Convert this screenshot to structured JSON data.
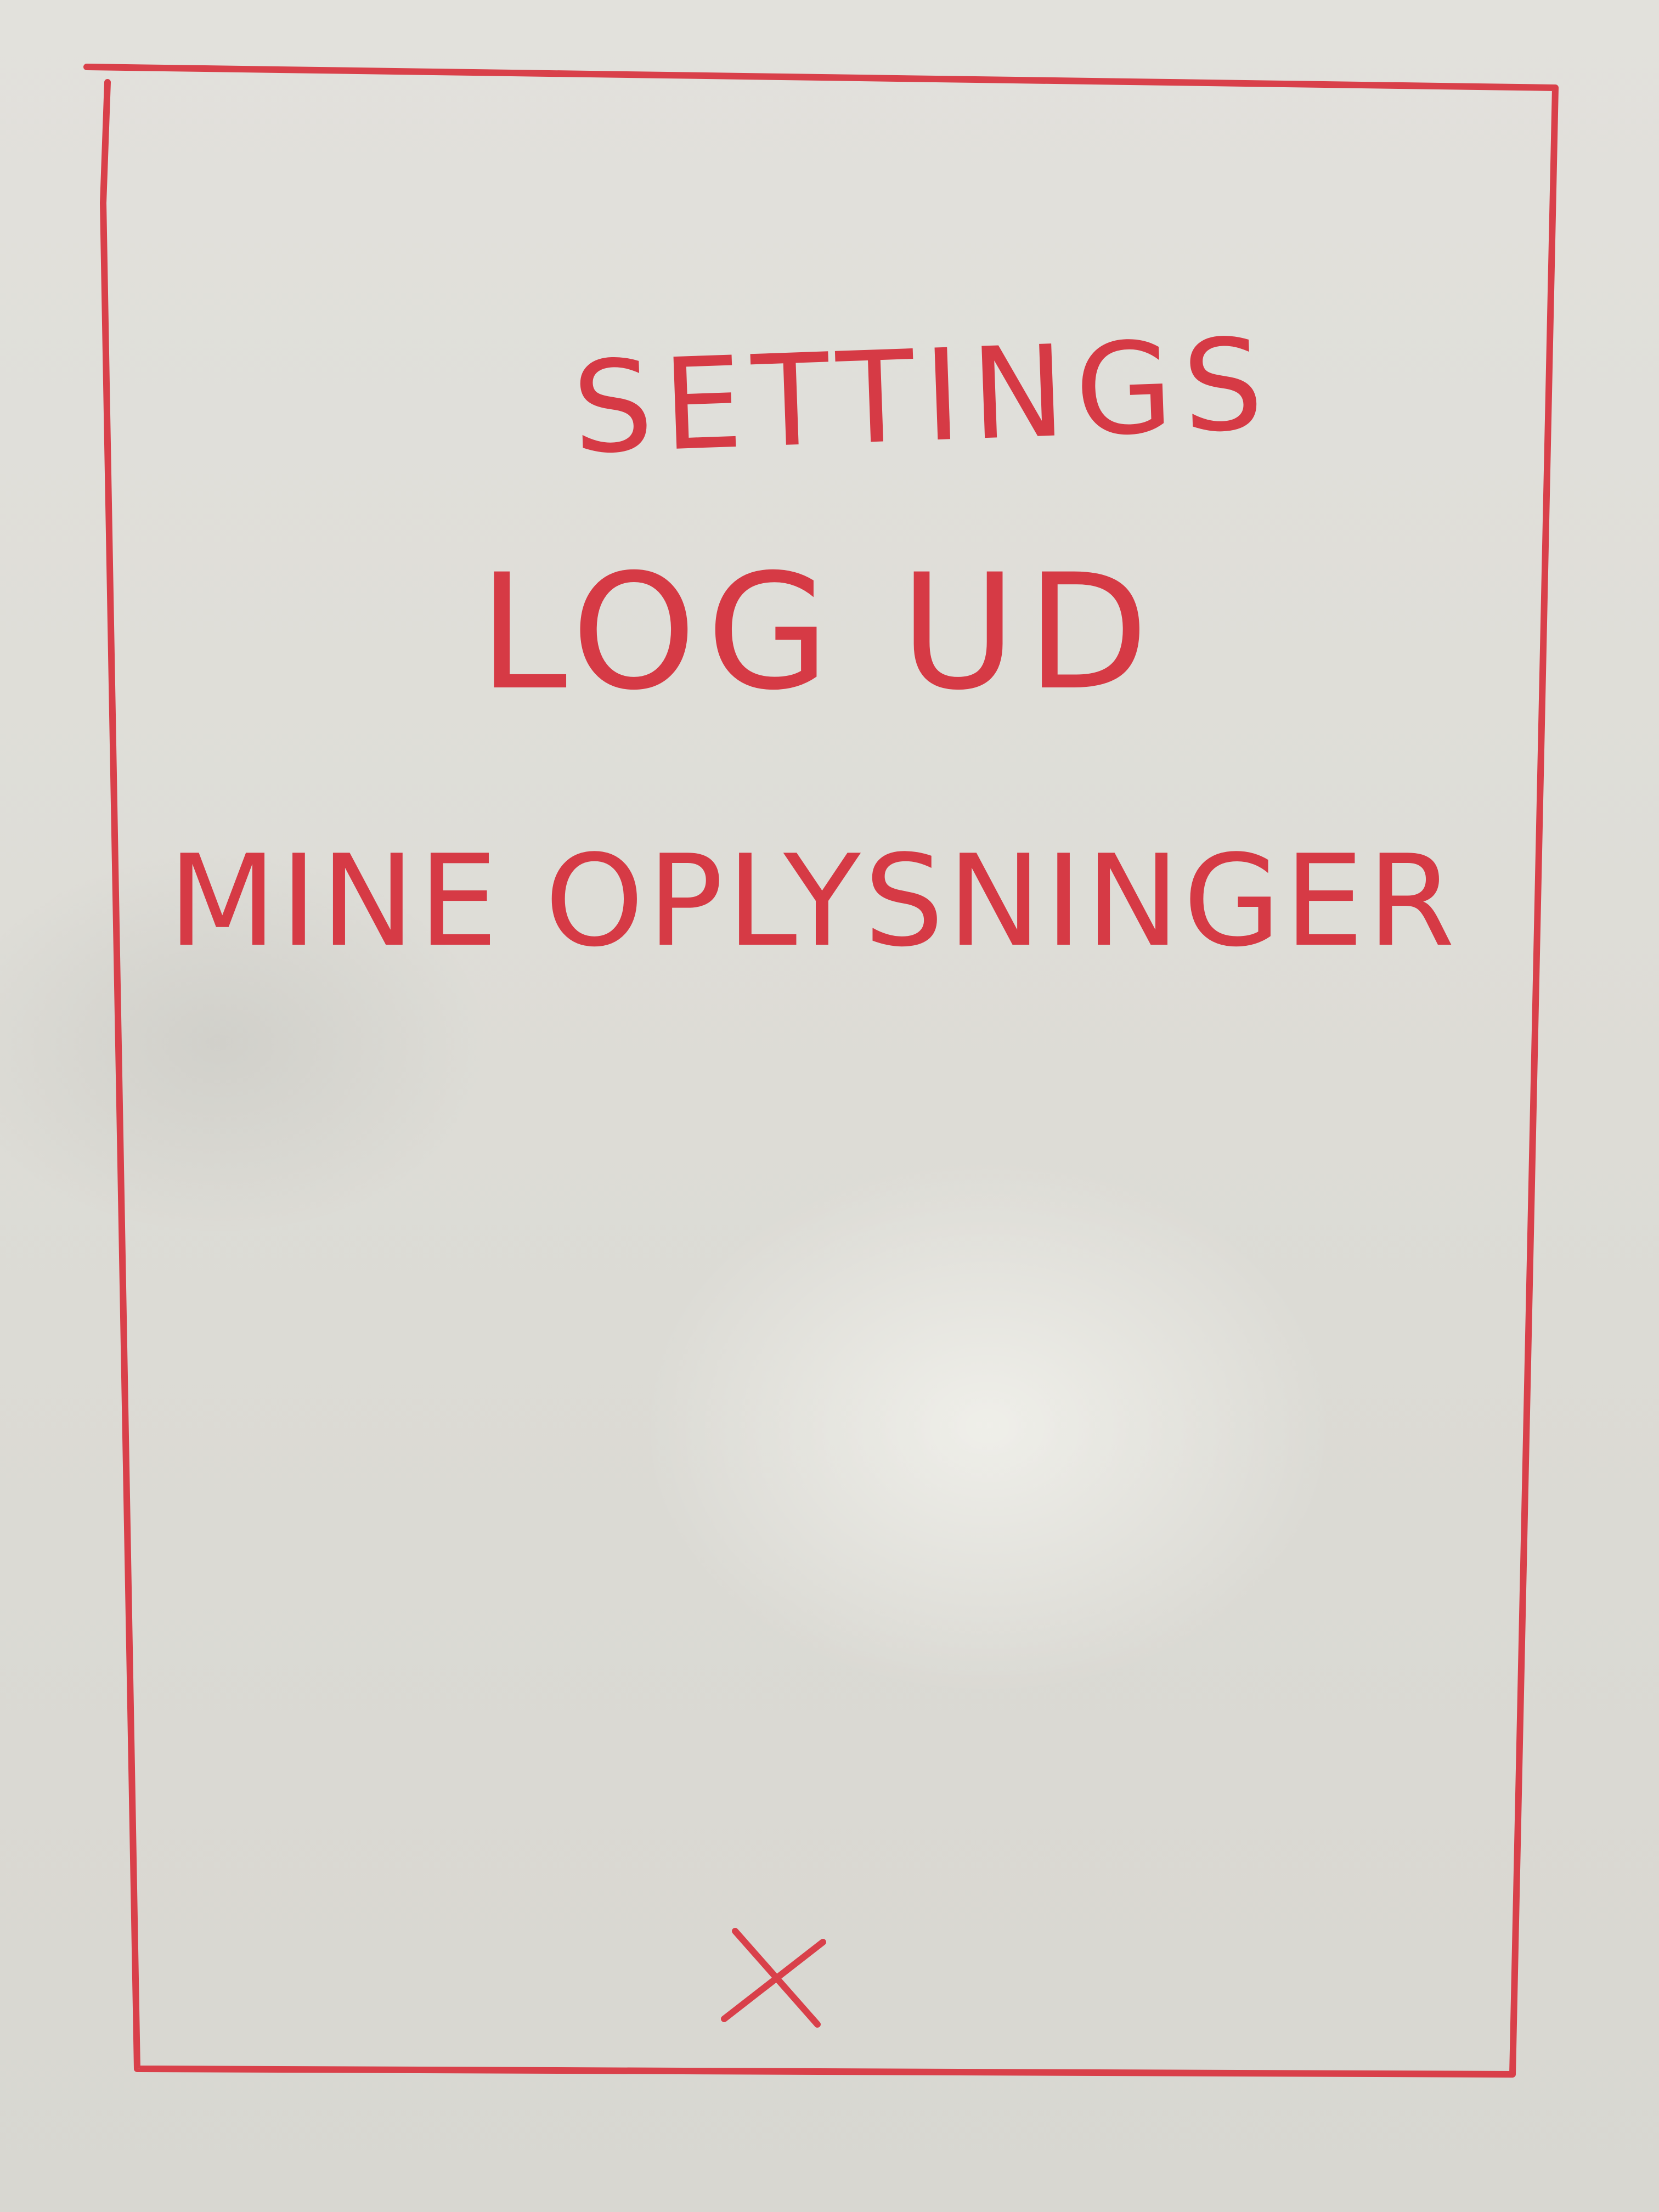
{
  "menu": {
    "settings_label": "SETTINGS",
    "logout_label": "LOG UD",
    "my_info_label": "MINE OPLYSNINGER"
  },
  "close": {
    "icon": "close-icon",
    "glyph": "X"
  },
  "colors": {
    "marker": "#d9404a",
    "board": "#dddcd6"
  }
}
